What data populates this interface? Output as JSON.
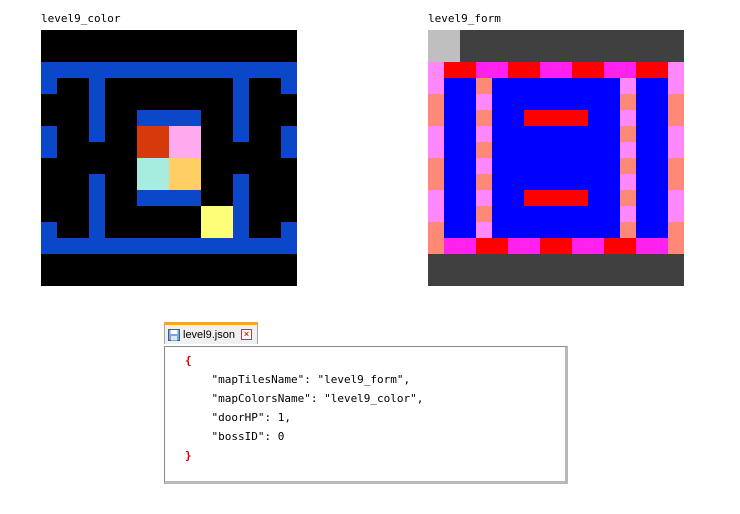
{
  "panels": {
    "color_map": {
      "label": "level9_color"
    },
    "form_map": {
      "label": "level9_form"
    }
  },
  "colors": {
    "black": "#000000",
    "royal_blue": "#0d47c9",
    "pure_blue": "#0000ff",
    "rust": "#d63a0a",
    "light_pink": "#ffaaee",
    "aqua": "#a6ecdf",
    "gold": "#ffcf66",
    "yellow": "#ffff77",
    "dark_gray": "#404040",
    "light_gray": "#bfbfbf",
    "red": "#ff0000",
    "magenta": "#ff22ee",
    "salmon": "#ff8877",
    "pink": "#ff88ff"
  },
  "editor": {
    "tab_label": "level9.json",
    "lines": [
      {
        "text": "{",
        "brace": true
      },
      {
        "text": "    \"mapTilesName\": \"level9_form\",",
        "brace": false
      },
      {
        "text": "    \"mapColorsName\": \"level9_color\",",
        "brace": false
      },
      {
        "text": "    \"doorHP\": 1,",
        "brace": false
      },
      {
        "text": "    \"bossID\": 0",
        "brace": false
      },
      {
        "text": "}",
        "brace": true
      }
    ]
  }
}
